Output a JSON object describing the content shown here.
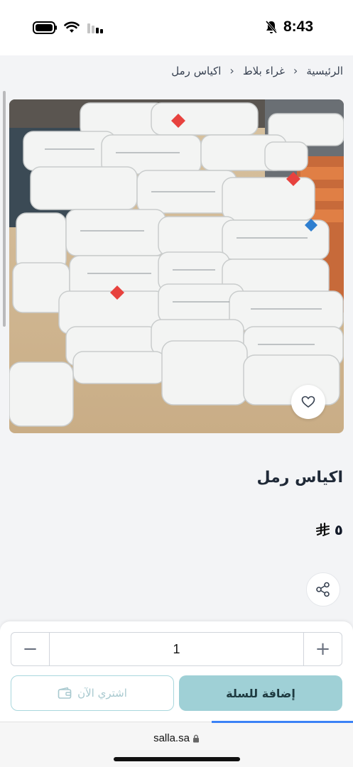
{
  "status_bar": {
    "time": "8:43",
    "icons": [
      "battery-icon",
      "wifi-icon",
      "cellular-signal-icon",
      "silent-bell-icon"
    ]
  },
  "breadcrumb": {
    "items": [
      "الرئيسية",
      "غراء بلاط",
      "اكياس رمل"
    ]
  },
  "product": {
    "image": "photo of stacked white sacks",
    "title": "اكياس رمل",
    "price": "٥",
    "currency_icon": "saudi-riyal-icon"
  },
  "purchase": {
    "quantity": "1",
    "add_to_cart_label": "إضافة للسلة",
    "buy_now_label": "اشتري الآن",
    "accent_color": "#9fd0d6"
  },
  "browser": {
    "url": "salla.sa"
  }
}
